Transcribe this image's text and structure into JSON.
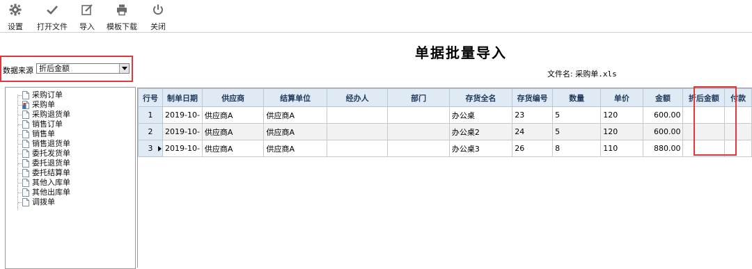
{
  "toolbar": {
    "buttons": [
      {
        "label": "设置",
        "icon": "gear-icon"
      },
      {
        "label": "打开文件",
        "icon": "check-icon"
      },
      {
        "label": "导入",
        "icon": "edit-icon"
      },
      {
        "label": "模板下载",
        "icon": "printer-icon"
      },
      {
        "label": "关闭",
        "icon": "power-icon"
      }
    ]
  },
  "page": {
    "title": "单据批量导入",
    "filename_label": "文件名:",
    "filename": "采购单.xls"
  },
  "data_source": {
    "label": "数据来源",
    "selected": "折后金额"
  },
  "tree": {
    "items": [
      "采购订单",
      "采购单",
      "采购退货单",
      "销售订单",
      "销售单",
      "销售退货单",
      "委托发货单",
      "委托退货单",
      "委托结算单",
      "其他入库单",
      "其他出库单",
      "调拨单"
    ],
    "selected_index": 1
  },
  "grid": {
    "columns": [
      "行号",
      "制单日期",
      "供应商",
      "结算单位",
      "经办人",
      "部门",
      "存货全名",
      "存货编号",
      "数量",
      "单价",
      "金额",
      "折后金额",
      "付款"
    ],
    "rows": [
      {
        "no": "1",
        "date": "2019-10-",
        "supplier": "供应商A",
        "settle": "供应商A",
        "handler": "",
        "dept": "",
        "item": "办公桌",
        "code": "23",
        "qty": "5",
        "price": "120",
        "amount": "600.00",
        "discount_amount": "",
        "pay": ""
      },
      {
        "no": "2",
        "date": "2019-10-",
        "supplier": "供应商A",
        "settle": "供应商A",
        "handler": "",
        "dept": "",
        "item": "办公桌2",
        "code": "24",
        "qty": "5",
        "price": "120",
        "amount": "600.00",
        "discount_amount": "",
        "pay": ""
      },
      {
        "no": "3",
        "date": "2019-10-",
        "supplier": "供应商A",
        "settle": "供应商A",
        "handler": "",
        "dept": "",
        "item": "办公桌3",
        "code": "26",
        "qty": "8",
        "price": "110",
        "amount": "880.00",
        "discount_amount": "",
        "pay": ""
      }
    ]
  },
  "colors": {
    "highlight_red": "#e0383a",
    "header_bg": "#dfeaf5",
    "icon_gray": "#6b6b6b"
  }
}
